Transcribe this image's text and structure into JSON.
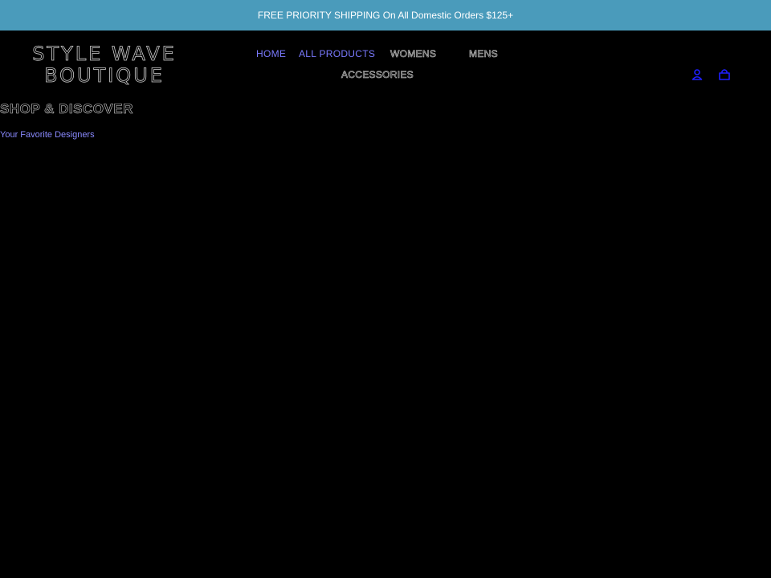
{
  "announcement": {
    "text": "FREE PRIORITY SHIPPING On All Domestic Orders $125+"
  },
  "logo": {
    "line1": "STYLE WAVE",
    "line2": "BOUTIQUE"
  },
  "nav": {
    "items": [
      {
        "label": "HOME"
      },
      {
        "label": "ALL PRODUCTS"
      },
      {
        "label": "WOMENS"
      },
      {
        "label": "MENS"
      },
      {
        "label": "ACCESSORIES"
      }
    ]
  },
  "icons": {
    "account": "user-icon",
    "cart": "cart-icon",
    "color": "#1f1fff"
  },
  "hero": {
    "title": "SHOP & DISCOVER",
    "subtitle": "Your Favorite Designers"
  },
  "colors": {
    "announcement_bg": "#4a9bbb",
    "link_blue": "#7a7aff",
    "background": "#000000"
  }
}
